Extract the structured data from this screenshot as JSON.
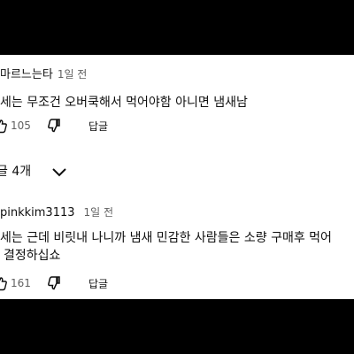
{
  "comments": [
    {
      "author": "마르느는타",
      "time": "1일 전",
      "lines": [
        "세는 무조건 오버쿡해서 먹어야함 아니면 냄새남"
      ],
      "likes": "105",
      "reply_label": "답글"
    },
    {
      "author": "pinkkim3113",
      "time": "1일 전",
      "lines": [
        "세는 근데 비릿내 나니까 냄새 민감한 사람들은 소량 구매후 먹어",
        "결정하십쇼"
      ],
      "likes": "161",
      "reply_label": "답글"
    }
  ],
  "replies_toggle": {
    "label": "글 4개"
  },
  "icons": {
    "like": "thumb-up-icon",
    "dislike": "thumb-down-icon",
    "expand": "chevron-down-icon"
  }
}
